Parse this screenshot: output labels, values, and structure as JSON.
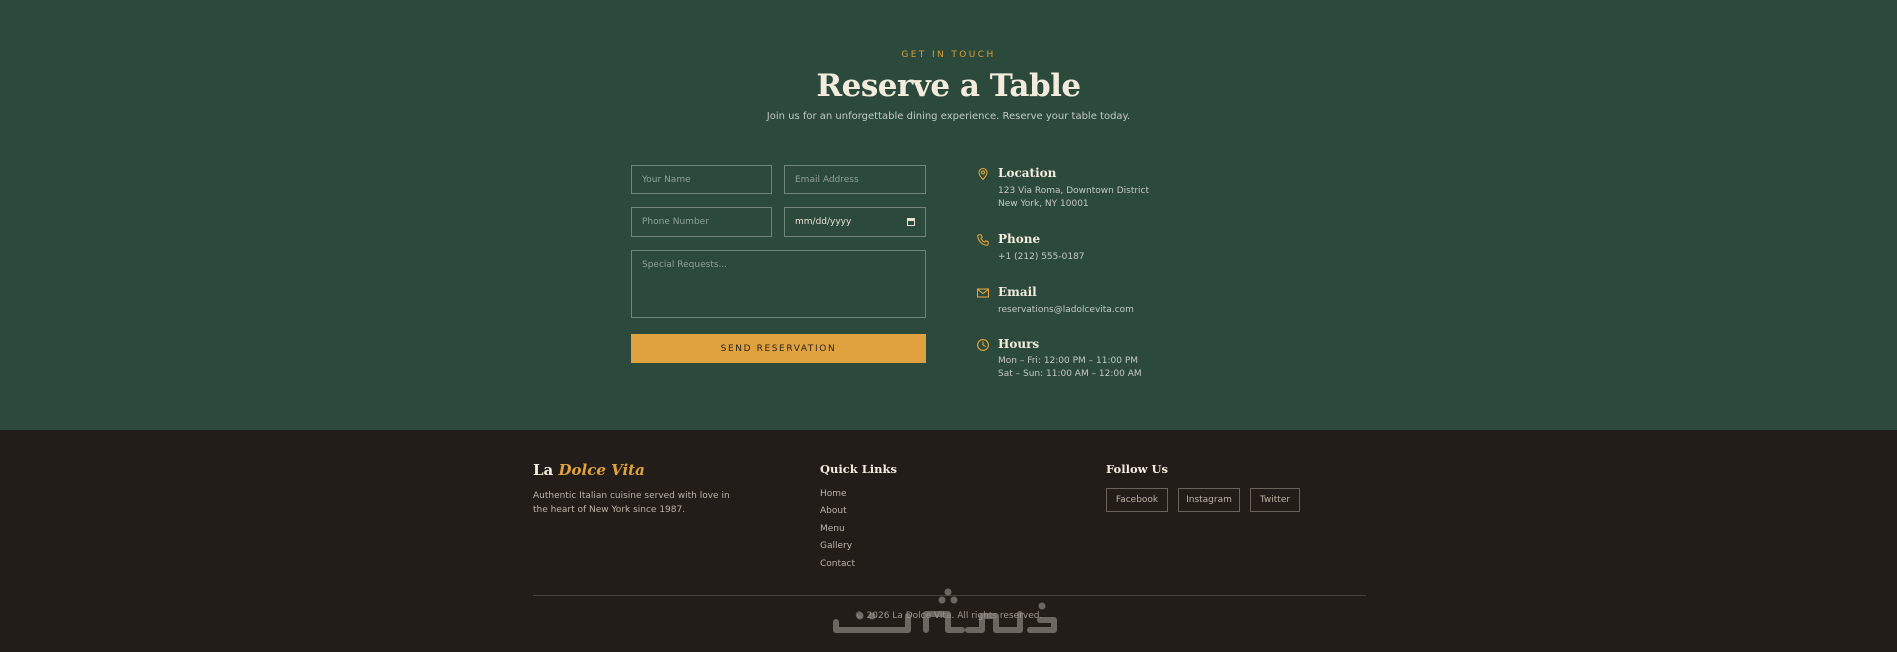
{
  "reservation": {
    "eyebrow": "GET IN TOUCH",
    "title": "Reserve a Table",
    "subtitle": "Join us for an unforgettable dining experience. Reserve your table today.",
    "form": {
      "name_placeholder": "Your Name",
      "email_placeholder": "Email Address",
      "phone_placeholder": "Phone Number",
      "date_value": "mm/dd/yyyy",
      "requests_placeholder": "Special Requests...",
      "submit_label": "SEND RESERVATION"
    },
    "info": {
      "location": {
        "icon": "map-pin-icon",
        "title": "Location",
        "line1": "123 Via Roma, Downtown District",
        "line2": "New York, NY 10001"
      },
      "phone": {
        "icon": "phone-icon",
        "title": "Phone",
        "line1": "+1 (212) 555-0187"
      },
      "email": {
        "icon": "mail-icon",
        "title": "Email",
        "line1": "reservations@ladolcevita.com"
      },
      "hours": {
        "icon": "clock-icon",
        "title": "Hours",
        "line1": "Mon – Fri: 12:00 PM – 11:00 PM",
        "line2": "Sat – Sun: 11:00 AM – 12:00 AM"
      }
    }
  },
  "footer": {
    "brand_prefix": "La ",
    "brand_accent": "Dolce Vita",
    "description": "Authentic Italian cuisine served with love in the heart of New York since 1987.",
    "quick_links_heading": "Quick Links",
    "quick_links": [
      "Home",
      "About",
      "Menu",
      "Gallery",
      "Contact"
    ],
    "follow_heading": "Follow Us",
    "social": [
      "Facebook",
      "Instagram",
      "Twitter"
    ],
    "copyright": "© 2026 La Dolce Vita. All rights reserved.",
    "watermark_text": "خمسات"
  },
  "colors": {
    "section_green": "#2b4a3b",
    "footer_dark": "#231d1a",
    "accent_gold": "#e0a23f",
    "cream": "#f3ecdd"
  }
}
